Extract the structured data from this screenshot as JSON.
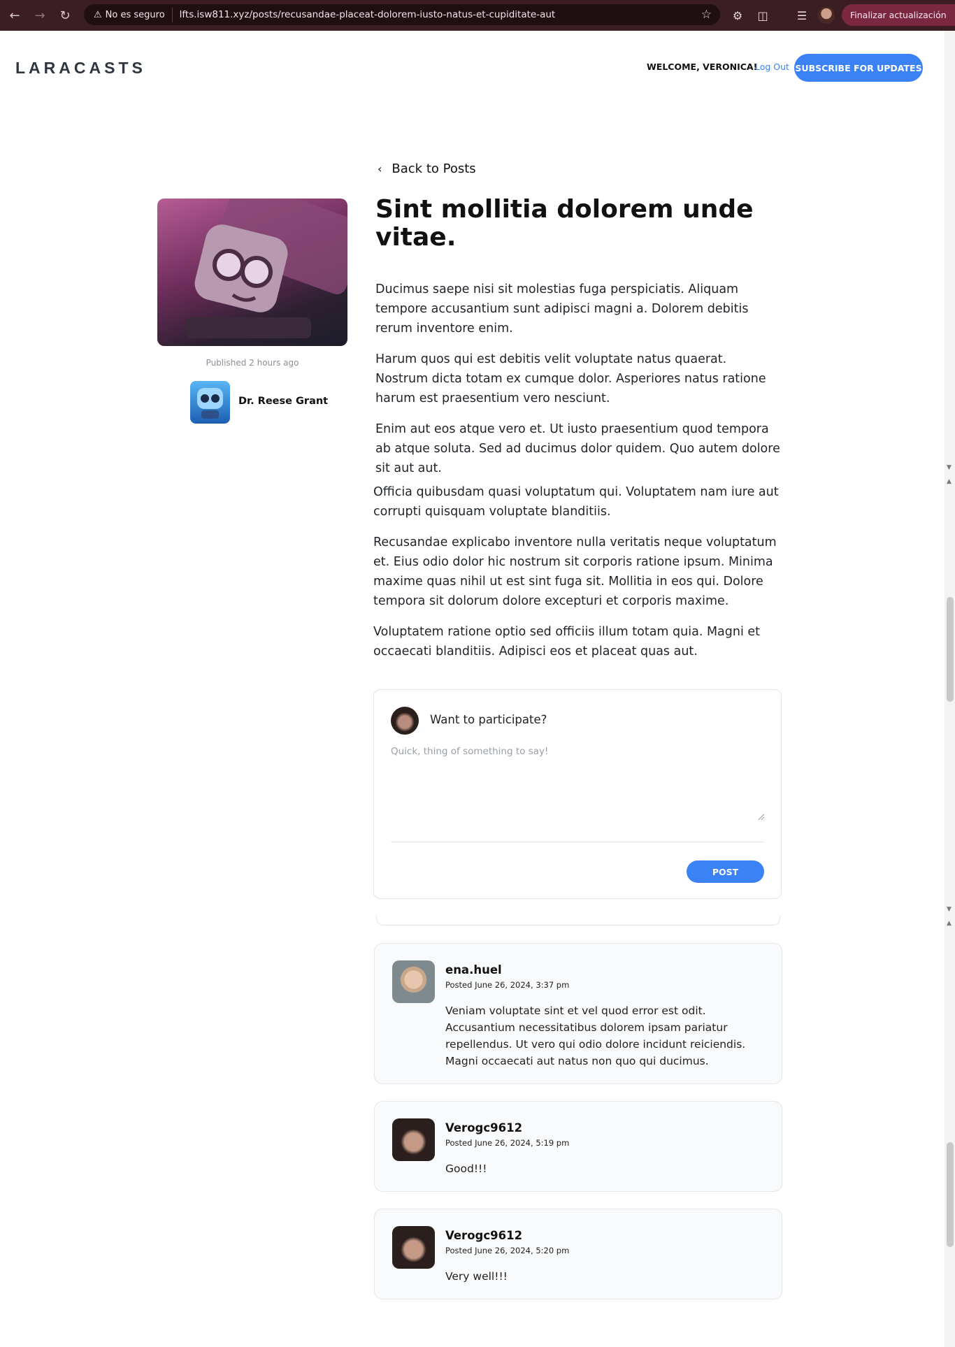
{
  "browser": {
    "security_label": "No es seguro",
    "url": "lfts.isw811.xyz/posts/recusandae-placeat-dolorem-iusto-natus-et-cupiditate-aut",
    "update_label": "Finalizar actualización"
  },
  "header": {
    "logo_text": "LARACASTS",
    "welcome": "WELCOME, VERONICA!",
    "logout": "Log Out",
    "subscribe": "SUBSCRIBE FOR UPDATES"
  },
  "post": {
    "back_label": "Back to Posts",
    "published": "Published 2 hours ago",
    "author": "Dr. Reese Grant",
    "title": "Sint mollitia dolorem unde vitae.",
    "paragraphs": [
      "Ducimus saepe nisi sit molestias fuga perspiciatis. Aliquam tempore accusantium sunt adipisci magni a. Dolorem debitis rerum inventore enim.",
      "Harum quos qui est debitis velit voluptate natus quaerat. Nostrum dicta totam ex cumque dolor. Asperiores natus ratione harum est praesentium vero nesciunt.",
      "Enim aut eos atque vero et. Ut iusto praesentium quod tempora ab atque soluta. Sed ad ducimus dolor quidem. Quo autem dolore sit aut aut.",
      "Officia quibusdam quasi voluptatum qui. Voluptatem nam iure aut corrupti quisquam voluptate blanditiis.",
      "Recusandae explicabo inventore nulla veritatis neque voluptatum et. Eius odio dolor hic nostrum sit corporis ratione ipsum. Minima maxime quas nihil ut est sint fuga sit. Mollitia in eos qui. Dolore tempora sit dolorum dolore excepturi et corporis maxime.",
      "Voluptatem ratione optio sed officiis illum totam quia. Magni et occaecati blanditiis. Adipisci eos et placeat quas aut."
    ]
  },
  "comment_form": {
    "heading": "Want to participate?",
    "placeholder": "Quick, thing of something to say!",
    "submit": "POST"
  },
  "comments": [
    {
      "user": "ena.huel",
      "date": "Posted June 26, 2024, 3:37 pm",
      "body": "Veniam voluptate sint et vel quod error est odit. Accusantium necessitatibus dolorem ipsam pariatur repellendus. Ut vero qui odio dolore incidunt reiciendis. Magni occaecati aut natus non quo qui ducimus."
    },
    {
      "user": "Verogc9612",
      "date": "Posted June 26, 2024, 5:19 pm",
      "body": "Good!!!"
    },
    {
      "user": "Verogc9612",
      "date": "Posted June 26, 2024, 5:20 pm",
      "body": "Very well!!!"
    }
  ],
  "colors": {
    "accent": "#3b82f6",
    "chrome": "#3b1d24"
  }
}
